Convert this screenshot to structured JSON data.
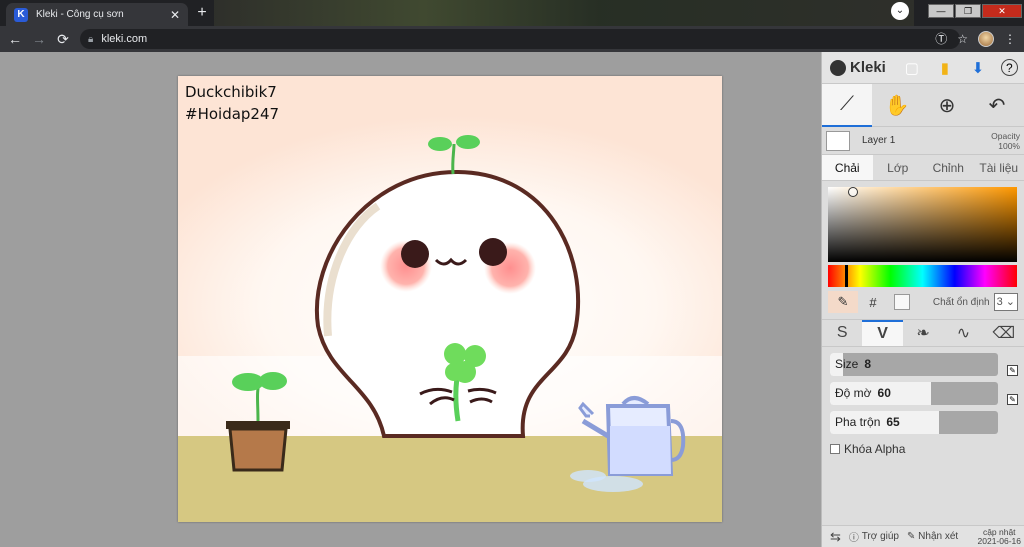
{
  "browser": {
    "tab_title": "Kleki - Công cụ sơn",
    "tab_close": "✕",
    "new_tab": "+",
    "url": "kleki.com",
    "back": "←",
    "forward": "→",
    "reload": "⟳",
    "translate_icon": "Ⓣ",
    "star_icon": "☆",
    "menu_icon": "⋮",
    "profile_icon": "⌄",
    "win_min": "—",
    "win_max": "❐",
    "win_close": "✕"
  },
  "canvas": {
    "signature_line1": "Duckchibik7",
    "signature_line2": "#Hoidap247"
  },
  "panel": {
    "logo": "Kleki",
    "new_icon": "▢",
    "save_icon": "▮",
    "download_icon": "⬇",
    "help_icon": "?",
    "tools": {
      "brush": "⟋",
      "hand": "✋",
      "zoom": "⊕",
      "undo": "↶"
    },
    "layer": {
      "name": "Layer 1",
      "opacity_label": "Opacity",
      "opacity_value": "100%"
    },
    "tabs": [
      "Chải",
      "Lớp",
      "Chỉnh",
      "Tài liệu"
    ],
    "color": {
      "eyedropper": "✎",
      "hex": "#",
      "mode_label": "Chất ổn định",
      "mode_value": "3"
    },
    "brushes": [
      "S",
      "V",
      "❧",
      "∿",
      "⌫"
    ],
    "sliders": [
      {
        "label": "Size",
        "value": "8",
        "fraction": 0.08
      },
      {
        "label": "Độ mờ",
        "value": "60",
        "fraction": 0.6
      },
      {
        "label": "Pha trộn",
        "value": "65",
        "fraction": 0.65
      }
    ],
    "alpha_lock": "Khóa Alpha",
    "footer": {
      "swap": "⇆",
      "help": "Trợ giúp",
      "feedback": "Nhận xét",
      "update_line1": "cập nhật",
      "update_line2": "2021-06-16"
    }
  }
}
